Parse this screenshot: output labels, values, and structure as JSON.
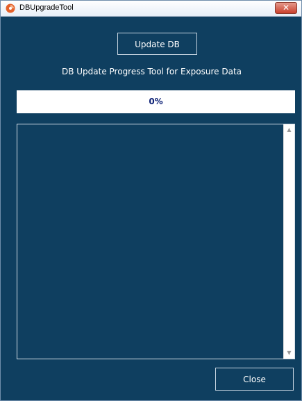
{
  "window": {
    "title": "DBUpgradeTool",
    "close_glyph": "✕"
  },
  "toolbar": {
    "update_label": "Update DB"
  },
  "subtitle": "DB Update Progress Tool for Exposure Data",
  "progress": {
    "value": 0,
    "label": "0%"
  },
  "log": {
    "text": "",
    "scroll_up_glyph": "▲",
    "scroll_down_glyph": "▼"
  },
  "footer": {
    "close_label": "Close"
  },
  "colors": {
    "background": "#0f3f60",
    "progress_text": "#0b1f74",
    "app_icon": "#e5622b"
  }
}
